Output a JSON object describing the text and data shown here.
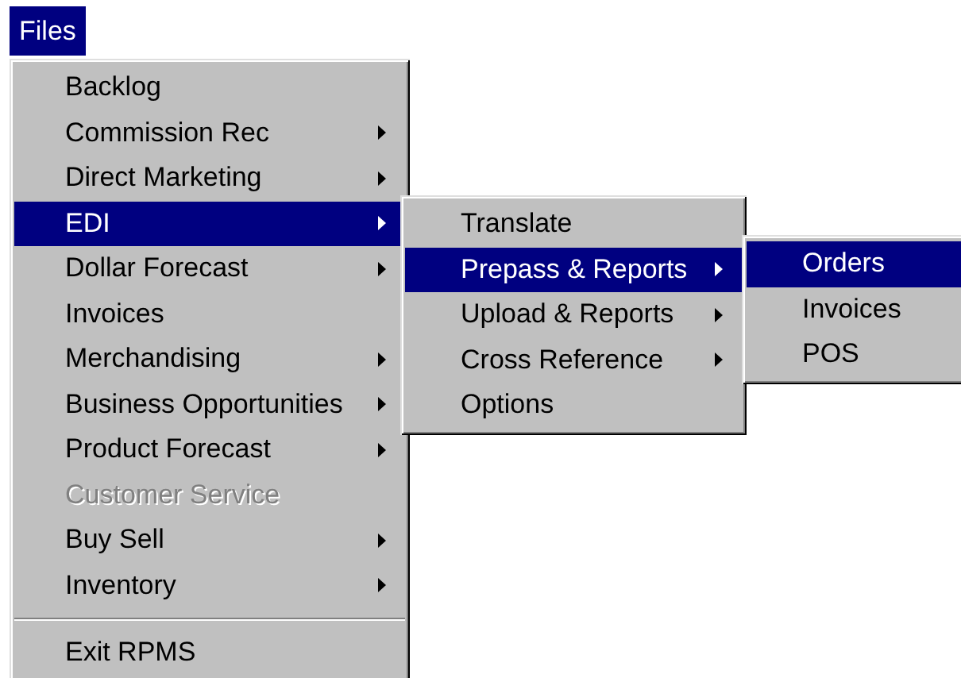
{
  "menubar": {
    "items": [
      {
        "label": "Files",
        "selected": true
      }
    ]
  },
  "menus": [
    {
      "items": [
        {
          "kind": "command",
          "label": "Backlog",
          "selected": false,
          "disabled": false
        },
        {
          "kind": "submenu",
          "label": "Commission Rec",
          "selected": false,
          "disabled": false
        },
        {
          "kind": "submenu",
          "label": "Direct Marketing",
          "selected": false,
          "disabled": false
        },
        {
          "kind": "submenu",
          "label": "EDI",
          "selected": true,
          "disabled": false
        },
        {
          "kind": "submenu",
          "label": "Dollar Forecast",
          "selected": false,
          "disabled": false
        },
        {
          "kind": "command",
          "label": "Invoices",
          "selected": false,
          "disabled": false
        },
        {
          "kind": "submenu",
          "label": "Merchandising",
          "selected": false,
          "disabled": false
        },
        {
          "kind": "submenu",
          "label": "Business Opportunities",
          "selected": false,
          "disabled": false
        },
        {
          "kind": "submenu",
          "label": "Product Forecast",
          "selected": false,
          "disabled": false
        },
        {
          "kind": "command",
          "label": "Customer Service",
          "selected": false,
          "disabled": true
        },
        {
          "kind": "submenu",
          "label": "Buy Sell",
          "selected": false,
          "disabled": false
        },
        {
          "kind": "submenu",
          "label": "Inventory",
          "selected": false,
          "disabled": false
        },
        {
          "kind": "separator"
        },
        {
          "kind": "command",
          "label": "Exit RPMS",
          "selected": false,
          "disabled": false
        }
      ]
    },
    {
      "items": [
        {
          "kind": "command",
          "label": "Translate",
          "selected": false,
          "disabled": false
        },
        {
          "kind": "submenu",
          "label": "Prepass & Reports",
          "selected": true,
          "disabled": false
        },
        {
          "kind": "submenu",
          "label": "Upload & Reports",
          "selected": false,
          "disabled": false
        },
        {
          "kind": "submenu",
          "label": "Cross Reference",
          "selected": false,
          "disabled": false
        },
        {
          "kind": "command",
          "label": "Options",
          "selected": false,
          "disabled": false
        }
      ]
    },
    {
      "items": [
        {
          "kind": "command",
          "label": "Orders",
          "selected": true,
          "disabled": false
        },
        {
          "kind": "command",
          "label": "Invoices",
          "selected": false,
          "disabled": false
        },
        {
          "kind": "command",
          "label": "POS",
          "selected": false,
          "disabled": false
        }
      ]
    }
  ]
}
